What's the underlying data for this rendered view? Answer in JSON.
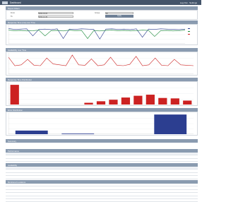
{
  "window": {
    "title": "Dashboard",
    "right_text": "Log Out · Settings",
    "accent": "#44546a",
    "panel_color": "#8a9bb0"
  },
  "filters": {
    "header": "Report Filters",
    "from_label": "From",
    "from_value": "2014-01-01",
    "to_label": "To",
    "to_value": "2014-12-31",
    "group_label": "Group",
    "group_value": "All",
    "apply_label": "Apply"
  },
  "panels": {
    "chart1_header": "Response Time (ms) over Time",
    "chart2_header": "Availability over Time",
    "chart3_header": "Response Time Distribution",
    "chart4_header": "Error Distribution",
    "summary_header": "Summary",
    "table1_header": "Performance",
    "table2_header": "Availability",
    "table3_header": "Monitored Locations"
  },
  "legend": {
    "items": [
      "",
      "",
      ""
    ],
    "colors": [
      "#2c3e90",
      "#1a8a3a",
      "#cc2222"
    ]
  },
  "chart_data": [
    {
      "type": "line",
      "series": [
        {
          "values": [
            58,
            55,
            56,
            57,
            30,
            55,
            56,
            54,
            57,
            20,
            56,
            55,
            57,
            56,
            55,
            18,
            56,
            57,
            55,
            56,
            54,
            57,
            25,
            56,
            55,
            57,
            56,
            55,
            54,
            56
          ]
        },
        {
          "values": [
            52,
            50,
            51,
            49,
            50,
            52,
            30,
            50,
            51,
            49,
            52,
            50,
            51,
            20,
            50,
            49,
            51,
            52,
            50,
            51,
            49,
            50,
            52,
            51,
            28,
            50,
            51,
            49,
            50,
            52
          ]
        }
      ],
      "ylim": [
        0,
        70
      ]
    },
    {
      "type": "line",
      "series": [
        {
          "values": [
            40,
            20,
            22,
            35,
            21,
            20,
            38,
            24,
            22,
            20,
            45,
            22,
            21,
            36,
            20,
            22,
            40,
            21,
            20,
            23,
            42,
            20,
            22,
            38,
            21,
            20,
            35,
            22,
            21,
            20
          ]
        }
      ],
      "ylim": [
        0,
        50
      ]
    },
    {
      "type": "bar",
      "categories": [
        "",
        "",
        "",
        "",
        "",
        "",
        "",
        "",
        "",
        "",
        "",
        ""
      ],
      "values": [
        90,
        0,
        0,
        0,
        0,
        0,
        8,
        15,
        22,
        32,
        40,
        45
      ],
      "extra_values": [
        30,
        28,
        18
      ],
      "ylim": [
        0,
        100
      ]
    },
    {
      "type": "bar",
      "categories": [
        "",
        "",
        "",
        ""
      ],
      "values": [
        12,
        2,
        0,
        65
      ],
      "ylim": [
        0,
        70
      ]
    }
  ],
  "table1": {
    "columns": [
      "",
      "",
      "",
      ""
    ],
    "rows": [
      [
        "",
        "",
        "",
        ""
      ],
      [
        "",
        "",
        "",
        ""
      ]
    ]
  },
  "table2": {
    "columns": [
      "",
      "",
      "",
      ""
    ],
    "rows": [
      [
        "",
        "",
        "",
        ""
      ],
      [
        "",
        "",
        "",
        ""
      ],
      [
        "",
        "",
        "",
        ""
      ]
    ]
  },
  "table3": {
    "rows": [
      [
        "",
        ""
      ],
      [
        "",
        ""
      ],
      [
        "",
        ""
      ],
      [
        "",
        ""
      ],
      [
        "",
        ""
      ],
      [
        "",
        ""
      ],
      [
        "",
        ""
      ]
    ]
  }
}
